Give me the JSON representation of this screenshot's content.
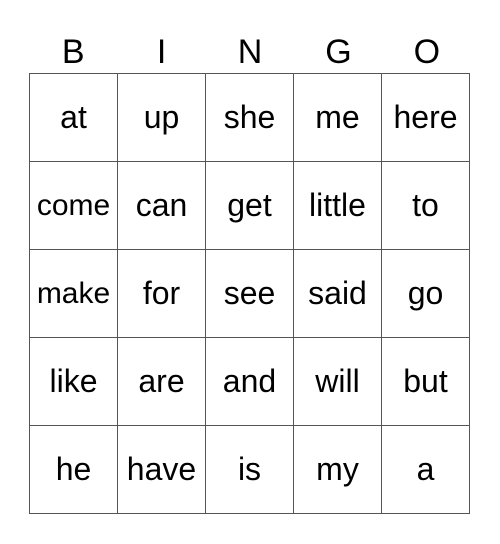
{
  "header": {
    "letters": [
      "B",
      "I",
      "N",
      "G",
      "O"
    ]
  },
  "board": {
    "rows": [
      [
        "at",
        "up",
        "she",
        "me",
        "here"
      ],
      [
        "come",
        "can",
        "get",
        "little",
        "to"
      ],
      [
        "make",
        "for",
        "see",
        "said",
        "go"
      ],
      [
        "like",
        "are",
        "and",
        "will",
        "but"
      ],
      [
        "he",
        "have",
        "is",
        "my",
        "a"
      ]
    ]
  }
}
